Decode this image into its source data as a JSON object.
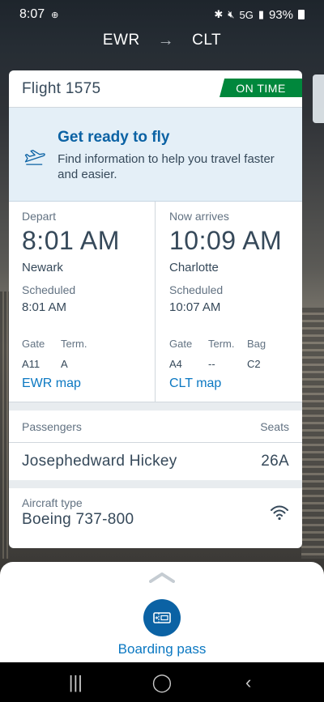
{
  "status_bar": {
    "time": "8:07",
    "network": "5G",
    "battery": "93%"
  },
  "route": {
    "from": "EWR",
    "arrow": "→",
    "to": "CLT"
  },
  "flight": {
    "title": "Flight 1575",
    "status": "ON TIME",
    "status_color": "#00873c"
  },
  "ready": {
    "title": "Get ready to fly",
    "text": "Find information to help you travel faster and easier."
  },
  "depart": {
    "label": "Depart",
    "time": "8:01 AM",
    "city": "Newark",
    "scheduled_label": "Scheduled",
    "scheduled_time": "8:01 AM",
    "gate_label": "Gate",
    "gate": "A11",
    "term_label": "Term.",
    "term": "A",
    "map_link": "EWR map"
  },
  "arrive": {
    "label": "Now arrives",
    "time": "10:09 AM",
    "city": "Charlotte",
    "scheduled_label": "Scheduled",
    "scheduled_time": "10:07 AM",
    "gate_label": "Gate",
    "gate": "A4",
    "term_label": "Term.",
    "term": "--",
    "bag_label": "Bag",
    "bag": "C2",
    "map_link": "CLT map"
  },
  "passengers": {
    "header": "Passengers",
    "seats_header": "Seats",
    "rows": [
      {
        "name": "Josephedward Hickey",
        "seat": "26A"
      }
    ]
  },
  "aircraft": {
    "label": "Aircraft type",
    "value": "Boeing 737-800",
    "icon": "wifi-icon"
  },
  "sheet": {
    "boarding_pass_label": "Boarding pass"
  },
  "colors": {
    "brand_blue": "#0b62a4",
    "link_blue": "#0b78c2",
    "ready_bg": "#e4eff7"
  }
}
